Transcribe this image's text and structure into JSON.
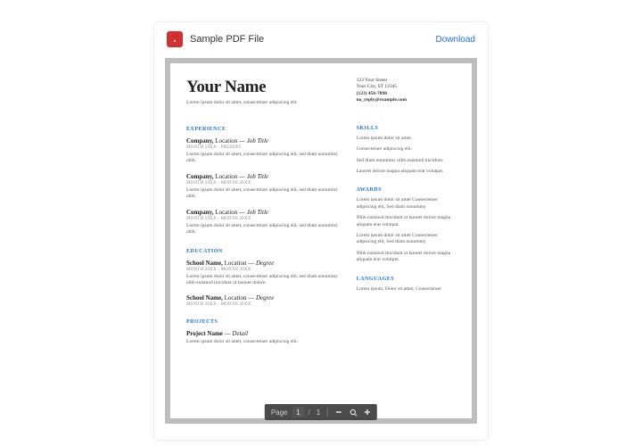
{
  "header": {
    "file_title": "Sample PDF File",
    "download_label": "Download"
  },
  "toolbar": {
    "page_label": "Page",
    "current_page": "1",
    "page_sep": "/",
    "total_pages": "1"
  },
  "resume": {
    "name": "Your Name",
    "tagline": "Lorem ipsum dolor sit amet, consectetuer adipiscing elit",
    "contact": {
      "street": "123 Your Street",
      "city": "Your City, ST 12345",
      "phone": "(123) 456-7890",
      "email": "no_reply@example.com"
    },
    "sections": {
      "experience_label": "EXPERIENCE",
      "education_label": "EDUCATION",
      "projects_label": "PROJECTS",
      "skills_label": "SKILLS",
      "awards_label": "AWARDS",
      "languages_label": "LANGUAGES"
    },
    "experience": [
      {
        "company": "Company,",
        "location": "Location",
        "dash": "—",
        "role": "Job Title",
        "dates": "MONTH 20XX - PRESENT",
        "body": "Lorem ipsum dolor sit amet, consectetuer adipiscing elit, sed diam nonummy nibh."
      },
      {
        "company": "Company,",
        "location": "Location",
        "dash": "—",
        "role": "Job Title",
        "dates": "MONTH 20XX - MONTH 20XX",
        "body": "Lorem ipsum dolor sit amet, consectetuer adipiscing elit, sed diam nonummy nibh."
      },
      {
        "company": "Company,",
        "location": "Location",
        "dash": "—",
        "role": "Job Title",
        "dates": "MONTH 20XX - MONTH 20XX",
        "body": "Lorem ipsum dolor sit amet, consectetuer adipiscing elit, sed diam nonummy nibh."
      }
    ],
    "education": [
      {
        "school": "School Name,",
        "location": "Location",
        "dash": "—",
        "degree": "Degree",
        "dates": "MONTH 20XX - MONTH 20XX",
        "body": "Lorem ipsum dolor sit amet, consectetuer adipiscing elit, sed diam nonummy nibh euismod tincidunt ut laoreet dolore."
      },
      {
        "school": "School Name,",
        "location": "Location",
        "dash": "—",
        "degree": "Degree",
        "dates": "MONTH 20XX - MONTH 20XX",
        "body": ""
      }
    ],
    "projects": [
      {
        "name": "Project Name",
        "dash": "—",
        "detail": "Detail",
        "body": "Lorem ipsum dolor sit amet, consectetuer adipiscing elit."
      }
    ],
    "skills": [
      "Lorem ipsum dolor sit amet.",
      "Consectetuer adipiscing elit.",
      "Sed diam nonummy nibh euismod tincidunt.",
      "Laoreet dolore magna aliquam erat volutpat."
    ],
    "awards": [
      "Lorem ipsum dolor sit amet Consectetuer adipiscing elit, Sed diam nonummy",
      "Nibh euismod tincidunt ut laoreet dolore magna aliquam erat volutpat.",
      "Lorem ipsum dolor sit amet Consectetuer adipiscing elit, Sed diam nonummy",
      "Nibh euismod tincidunt ut laoreet dolore magna aliquam erat volutpat."
    ],
    "languages": "Lorem ipsum, Dolor sit amet, Consectetuer"
  }
}
